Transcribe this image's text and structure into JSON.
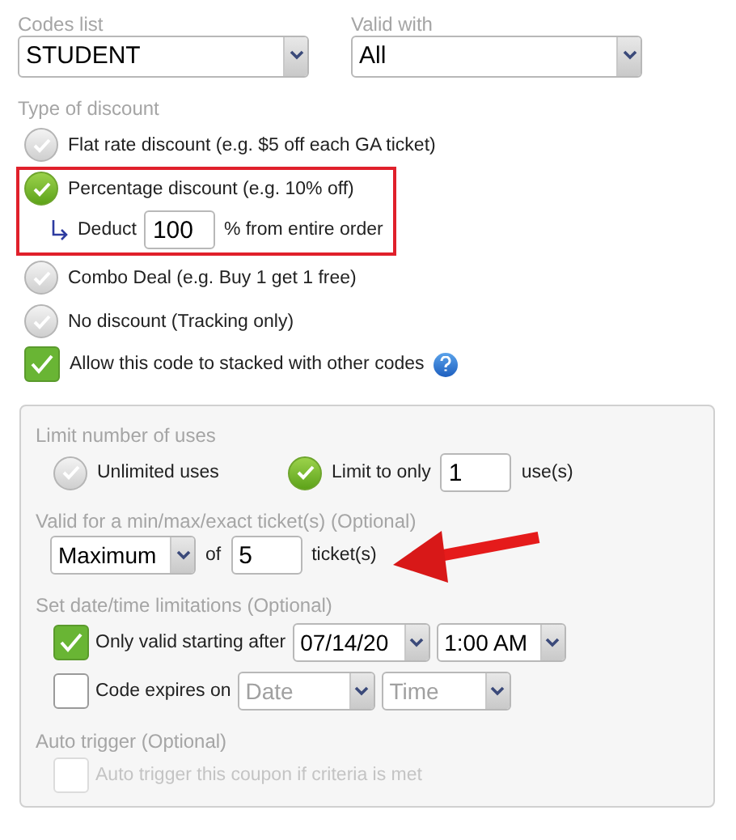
{
  "codes_list": {
    "label": "Codes list",
    "value": "STUDENT"
  },
  "valid_with": {
    "label": "Valid with",
    "value": "All"
  },
  "discount_type": {
    "label": "Type of discount",
    "options": [
      {
        "label": "Flat rate discount (e.g. $5 off each GA ticket)",
        "selected": false,
        "highlighted": false
      },
      {
        "label": "Percentage discount (e.g. 10% off)",
        "selected": true,
        "highlighted": true,
        "deduct": {
          "prefix": "Deduct",
          "value": "100",
          "suffix": "% from entire order"
        }
      },
      {
        "label": "Combo Deal (e.g. Buy 1 get 1 free)",
        "selected": false,
        "highlighted": false
      },
      {
        "label": "No discount (Tracking only)",
        "selected": false,
        "highlighted": false
      }
    ]
  },
  "allow_stacking": {
    "label": "Allow this code to stacked with other codes",
    "checked": true
  },
  "limits": {
    "uses": {
      "label": "Limit number of uses",
      "options": [
        {
          "label": "Unlimited uses",
          "selected": false
        },
        {
          "label": "Limit to only",
          "selected": true,
          "value": "1",
          "suffix": "use(s)"
        }
      ]
    },
    "tickets": {
      "label": "Valid for a min/max/exact ticket(s) (Optional)",
      "mode": "Maximum",
      "joiner": "of",
      "value": "5",
      "suffix": "ticket(s)"
    },
    "dates": {
      "label": "Set date/time limitations (Optional)",
      "rows": [
        {
          "label": "Only valid starting after",
          "checked": true,
          "date": "07/14/20",
          "time": "1:00 AM"
        },
        {
          "label": "Code expires on",
          "checked": false,
          "date_placeholder": "Date",
          "time_placeholder": "Time"
        }
      ]
    },
    "auto_trigger": {
      "label": "Auto trigger (Optional)",
      "option": {
        "label": "Auto trigger this coupon if criteria is met",
        "checked": false,
        "disabled": true
      }
    }
  }
}
